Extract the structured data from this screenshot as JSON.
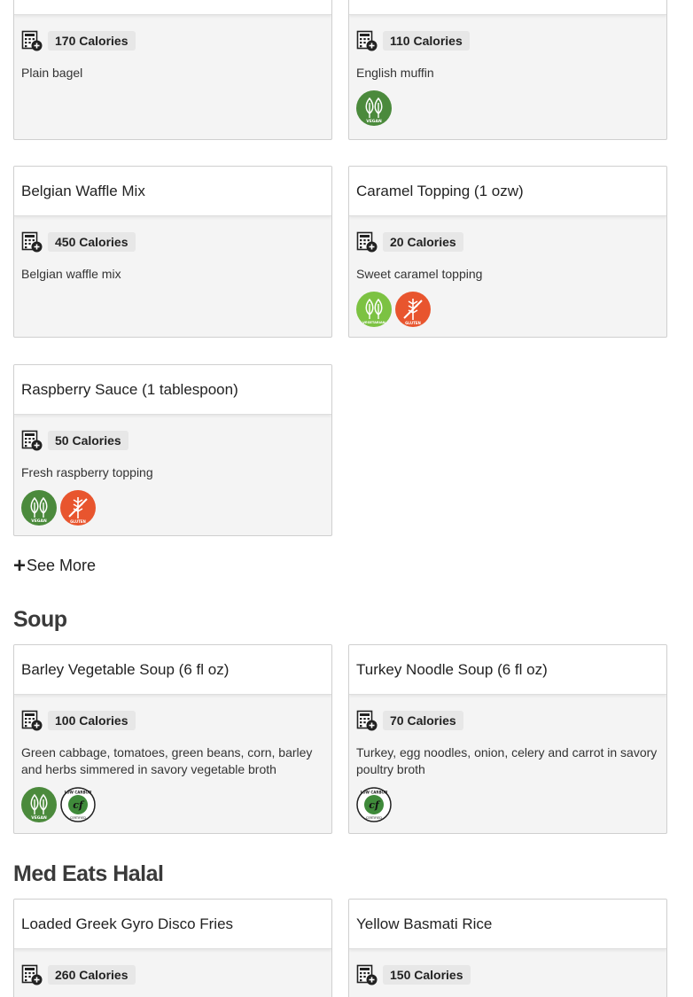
{
  "cards": {
    "bagel": {
      "calories": "170 Calories",
      "description": "Plain bagel"
    },
    "muffin": {
      "calories": "110 Calories",
      "description": "English muffin",
      "badges": [
        "vegan-icon"
      ]
    },
    "waffle": {
      "title": "Belgian Waffle Mix",
      "calories": "450 Calories",
      "description": "Belgian waffle mix"
    },
    "caramel": {
      "title": "Caramel Topping (1 ozw)",
      "calories": "20 Calories",
      "description": "Sweet caramel topping",
      "badges": [
        "vegetarian-icon",
        "avoiding-gluten-icon"
      ]
    },
    "raspberry": {
      "title": "Raspberry Sauce (1 tablespoon)",
      "calories": "50 Calories",
      "description": "Fresh raspberry topping",
      "badges": [
        "vegan-icon",
        "avoiding-gluten-icon"
      ]
    },
    "barley": {
      "title": "Barley Vegetable Soup (6 fl oz)",
      "calories": "100 Calories",
      "description": "Green cabbage, tomatoes, green beans, corn, barley and herbs simmered in savory vegetable broth",
      "badges": [
        "vegan-icon",
        "low-carbon-icon"
      ]
    },
    "turkey": {
      "title": "Turkey Noodle Soup (6 fl oz)",
      "calories": "70 Calories",
      "description": "Turkey, egg noodles, onion, celery and carrot in savory poultry broth",
      "badges": [
        "low-carbon-icon"
      ]
    },
    "gyro": {
      "title": "Loaded Greek Gyro Disco Fries",
      "calories": "260 Calories"
    },
    "rice": {
      "title": "Yellow Basmati Rice",
      "calories": "150 Calories"
    }
  },
  "see_more": "See More",
  "sections": {
    "soup": "Soup",
    "med_eats": "Med Eats Halal"
  },
  "colors": {
    "vegan": "#4b8a3c",
    "vegetarian": "#7cc242",
    "gluten": "#e8552e",
    "low_carbon": "#3f8a3a"
  }
}
